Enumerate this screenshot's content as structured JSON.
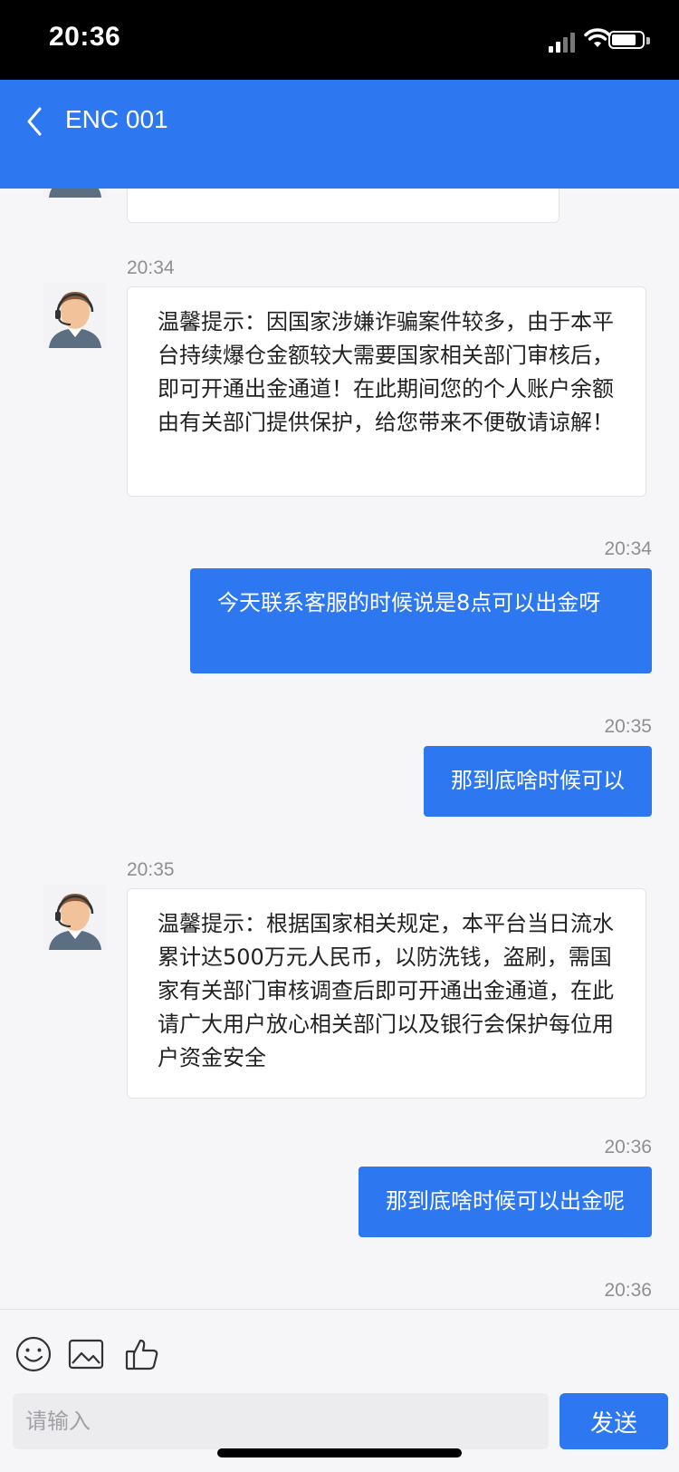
{
  "status_bar": {
    "time": "20:36"
  },
  "header": {
    "title": "ENC 001"
  },
  "messages": [
    {
      "side": "left",
      "time": "20:34",
      "text": "温馨提示：因国家涉嫌诈骗案件较多，由于本平台持续爆仓金额较大需要国家相关部门审核后，即可开通出金通道！在此期间您的个人账户余额由有关部门提供保护，给您带来不便敬请谅解！"
    },
    {
      "side": "right",
      "time": "20:34",
      "text": "今天联系客服的时候说是8点可以出金呀"
    },
    {
      "side": "right",
      "time": "20:35",
      "text": "那到底啥时候可以"
    },
    {
      "side": "left",
      "time": "20:35",
      "text": "温馨提示：根据国家相关规定，本平台当日流水累计达500万元人民币，以防洗钱，盗刷，需国家有关部门审核调查后即可开通出金通道，在此请广大用户放心相关部门以及银行会保护每位用户资金安全"
    },
    {
      "side": "right",
      "time": "20:36",
      "text": "那到底啥时候可以出金呢"
    },
    {
      "side": "right",
      "time": "20:36",
      "text": ""
    }
  ],
  "input": {
    "placeholder": "请输入",
    "send_label": "发送"
  },
  "icons": [
    "back-icon",
    "emoji-icon",
    "image-icon",
    "thumbs-up-icon",
    "agent-avatar-icon"
  ],
  "colors": {
    "accent": "#2d78f0",
    "status_bar": "#000000",
    "background": "#f6f6f8"
  }
}
